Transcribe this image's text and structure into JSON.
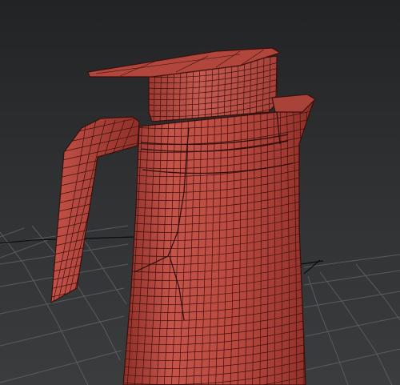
{
  "viewport": {
    "view": "perspective",
    "shading": "wireframe-over-shaded",
    "grid": true
  },
  "model": {
    "object": "pitcher",
    "material_color": "#b8473c",
    "wire_color": "#3a0f0c"
  },
  "colors": {
    "background": "#2e2f31",
    "grid_line": "#5a5b5e",
    "grid_axis": "#0b0b0b"
  }
}
